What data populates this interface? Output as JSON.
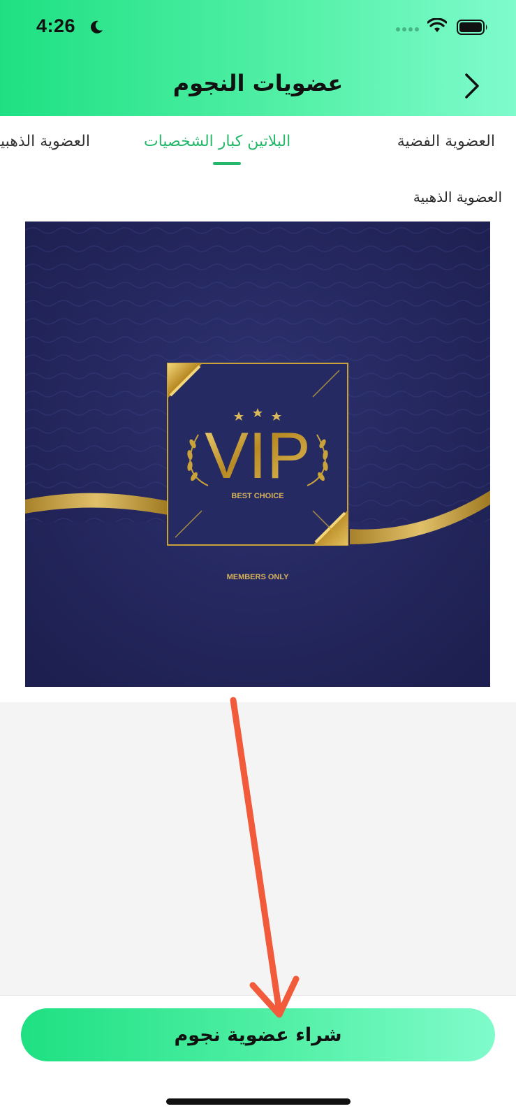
{
  "status_bar": {
    "time": "4:26"
  },
  "header": {
    "title": "عضويات النجوم"
  },
  "tabs": [
    {
      "label": "العضوية الفضية",
      "active": false
    },
    {
      "label": "البلاتين كبار الشخصيات",
      "active": true
    },
    {
      "label": "العضوية الذهبية",
      "active": false
    }
  ],
  "section": {
    "label": "العضوية الذهبية"
  },
  "vip_card": {
    "headline": "VIP",
    "tagline": "BEST CHOICE",
    "footer": "MEMBERS ONLY"
  },
  "buy_button": {
    "label": "شراء عضوية نجوم"
  },
  "colors": {
    "accent": "#25b86a",
    "gradient_start": "#1ee082",
    "gradient_end": "#7ffbcc",
    "vip_bg": "#24275a",
    "gold": "#c9a23a",
    "annotation": "#f25a3c"
  }
}
